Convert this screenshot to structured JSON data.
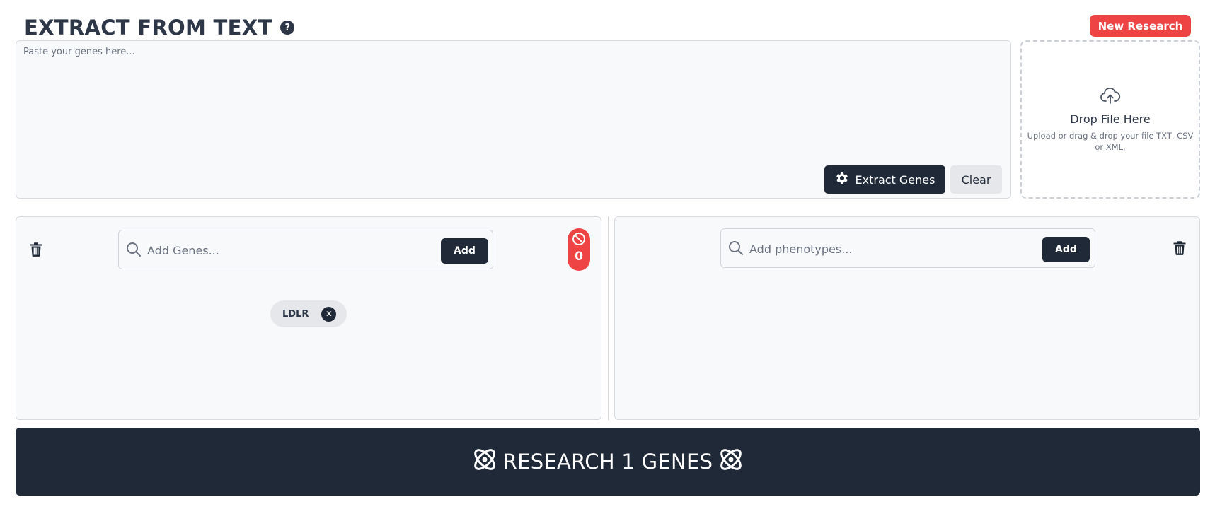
{
  "header": {
    "title": "EXTRACT FROM TEXT",
    "help_icon": "question-circle-icon",
    "new_research_label": "New Research"
  },
  "extract": {
    "placeholder": "Paste your genes here...",
    "value": "",
    "extract_label": "Extract Genes",
    "extract_icon": "gear-icon",
    "clear_label": "Clear"
  },
  "dropzone": {
    "icon": "cloud-upload-icon",
    "title": "Drop File Here",
    "subtitle": "Upload or drag & drop your file TXT, CSV or XML."
  },
  "genes_panel": {
    "search_placeholder": "Add Genes...",
    "add_label": "Add",
    "blocked_count": "0",
    "blocked_icon": "ban-icon",
    "genes": [
      "LDLR"
    ]
  },
  "phenotypes_panel": {
    "search_placeholder": "Add phenotypes...",
    "add_label": "Add",
    "phenotypes": []
  },
  "research": {
    "label": "RESEARCH 1 GENES",
    "icon": "atom-icon"
  },
  "colors": {
    "primary_dark": "#1f2937",
    "danger": "#ef4444",
    "panel_bg": "#f8f9fb",
    "border": "#d7dbe0"
  }
}
